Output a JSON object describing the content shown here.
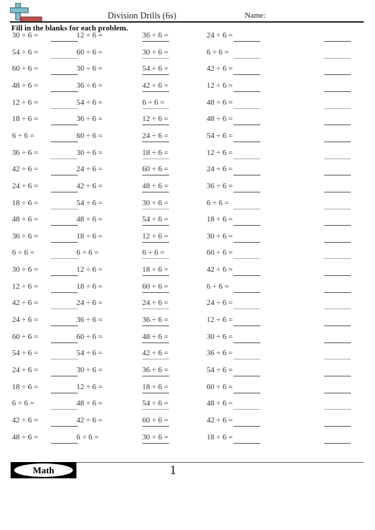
{
  "header": {
    "title": "Division Drills (6s)",
    "name_label": "Name:",
    "instructions": "Fill in the blanks for each problem."
  },
  "colors": {
    "logo_plus": "#7fbfc8",
    "logo_bar": "#c0504d",
    "rule": "#222222"
  },
  "problems": [
    [
      "30 ÷ 6 =",
      "12 ÷ 6 =",
      "36 ÷ 6 =",
      "24 ÷ 6 ="
    ],
    [
      "54 ÷ 6 =",
      "60 ÷ 6 =",
      "30 ÷ 6 =",
      "6 ÷ 6 ="
    ],
    [
      "60 ÷ 6 =",
      "30 ÷ 6 =",
      "54 ÷ 6 =",
      "42 ÷ 6 ="
    ],
    [
      "48 ÷ 6 =",
      "36 ÷ 6 =",
      "42 ÷ 6 =",
      "12 ÷ 6 ="
    ],
    [
      "12 ÷ 6 =",
      "54 ÷ 6 =",
      "6 ÷ 6 =",
      "48 ÷ 6 ="
    ],
    [
      "18 ÷ 6 =",
      "36 ÷ 6 =",
      "12 ÷ 6 =",
      "48 ÷ 6 ="
    ],
    [
      "6 ÷ 6 =",
      "60 ÷ 6 =",
      "24 ÷ 6 =",
      "54 ÷ 6 ="
    ],
    [
      "36 ÷ 6 =",
      "30 ÷ 6 =",
      "18 ÷ 6 =",
      "12 ÷ 6 ="
    ],
    [
      "42 ÷ 6 =",
      "24 ÷ 6 =",
      "60 ÷ 6 =",
      "24 ÷ 6 ="
    ],
    [
      "24 ÷ 6 =",
      "42 ÷ 6 =",
      "48 ÷ 6 =",
      "36 ÷ 6 ="
    ],
    [
      "18 ÷ 6 =",
      "54 ÷ 6 =",
      "30 ÷ 6 =",
      "6 ÷ 6 ="
    ],
    [
      "48 ÷ 6 =",
      "48 ÷ 6 =",
      "54 ÷ 6 =",
      "18 ÷ 6 ="
    ],
    [
      "36 ÷ 6 =",
      "18 ÷ 6 =",
      "12 ÷ 6 =",
      "30 ÷ 6 ="
    ],
    [
      "6 ÷ 6 =",
      "6 ÷ 6 =",
      "6 ÷ 6 =",
      "60 ÷ 6 ="
    ],
    [
      "30 ÷ 6 =",
      "12 ÷ 6 =",
      "18 ÷ 6 =",
      "42 ÷ 6 ="
    ],
    [
      "12 ÷ 6 =",
      "18 ÷ 6 =",
      "60 ÷ 6 =",
      "6 ÷ 6 ="
    ],
    [
      "42 ÷ 6 =",
      "24 ÷ 6 =",
      "24 ÷ 6 =",
      "24 ÷ 6 ="
    ],
    [
      "24 ÷ 6 =",
      "36 ÷ 6 =",
      "36 ÷ 6 =",
      "12 ÷ 6 ="
    ],
    [
      "60 ÷ 6 =",
      "60 ÷ 6 =",
      "48 ÷ 6 =",
      "30 ÷ 6 ="
    ],
    [
      "54 ÷ 6 =",
      "54 ÷ 6 =",
      "42 ÷ 6 =",
      "36 ÷ 6 ="
    ],
    [
      "24 ÷ 6 =",
      "30 ÷ 6 =",
      "36 ÷ 6 =",
      "54 ÷ 6 ="
    ],
    [
      "18 ÷ 6 =",
      "12 ÷ 6 =",
      "18 ÷ 6 =",
      "60 ÷ 6 ="
    ],
    [
      "6 ÷ 6 =",
      "48 ÷ 6 =",
      "54 ÷ 6 =",
      "48 ÷ 6 ="
    ],
    [
      "42 ÷ 6 =",
      "42 ÷ 6 =",
      "60 ÷ 6 =",
      "42 ÷ 6 ="
    ],
    [
      "48 ÷ 6 =",
      "6 ÷ 6 =",
      "30 ÷ 6 =",
      "18 ÷ 6 ="
    ]
  ],
  "footer": {
    "subject_badge": "Math",
    "page_number": "1"
  }
}
